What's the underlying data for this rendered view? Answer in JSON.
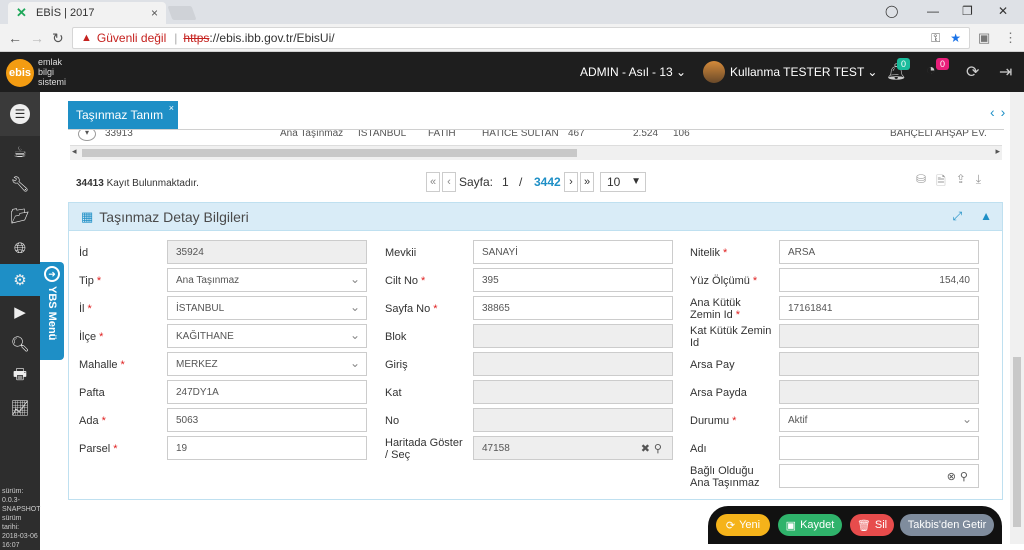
{
  "browser": {
    "tab_title": "EBİS | 2017",
    "tab_close": "×",
    "security_text": "Güvenli değil",
    "url_https": "https",
    "url_rest": "://ebis.ibb.gov.tr/EbisUi/"
  },
  "header": {
    "logo_text": "ebis",
    "logo_sub1": "emlak",
    "logo_sub2": "bilgi",
    "logo_sub3": "sistemi",
    "admin_label": "ADMIN - Asıl - 13",
    "user_label": "Kullanma TESTER TEST",
    "notif_count": "0",
    "alarm_count": "0"
  },
  "sidebar": {
    "ybs_label": "YBS Menü",
    "version_lines": [
      "sürüm:",
      "0.0.3-",
      "SNAPSHOT",
      "sürüm tarihi:",
      "2018-03-06",
      "16:07"
    ]
  },
  "page": {
    "tab_label": "Taşınmaz Tanım",
    "tab_close": "×"
  },
  "grid": {
    "partial_row": [
      "33913",
      "Ana Taşınmaz",
      "İSTANBUL",
      "FATİH",
      "HATİCE SULTAN",
      "467",
      "2.524",
      "106",
      "BAHÇELİ AHŞAP EV."
    ]
  },
  "pager": {
    "count_number": "34413",
    "count_text": " Kayıt Bulunmaktadır.",
    "page_label": "Sayfa:",
    "current_page": "1",
    "slash": "/",
    "total_pages": "3442",
    "page_size": "10"
  },
  "panel": {
    "title": "Taşınmaz Detay Bilgileri"
  },
  "form": {
    "col1": [
      {
        "label": "İd",
        "value": "35924",
        "required": false,
        "readonly": true
      },
      {
        "label": "Tip",
        "value": "Ana Taşınmaz",
        "required": true,
        "readonly": false,
        "dropdown": true
      },
      {
        "label": "İl",
        "value": "İSTANBUL",
        "required": true,
        "readonly": false,
        "dropdown": true
      },
      {
        "label": "İlçe",
        "value": "KAĞITHANE",
        "required": true,
        "readonly": false,
        "dropdown": true
      },
      {
        "label": "Mahalle",
        "value": "MERKEZ",
        "required": true,
        "readonly": false,
        "dropdown": true
      },
      {
        "label": "Pafta",
        "value": "247DY1A",
        "required": false,
        "readonly": false
      },
      {
        "label": "Ada",
        "value": "5063",
        "required": true,
        "readonly": false
      },
      {
        "label": "Parsel",
        "value": "19",
        "required": true,
        "readonly": false
      }
    ],
    "col2": [
      {
        "label": "Mevkii",
        "value": "SANAYİ",
        "required": false,
        "readonly": false
      },
      {
        "label": "Cilt No",
        "value": "395",
        "required": true,
        "readonly": false
      },
      {
        "label": "Sayfa No",
        "value": "38865",
        "required": true,
        "readonly": false
      },
      {
        "label": "Blok",
        "value": "",
        "required": false,
        "readonly": true
      },
      {
        "label": "Giriş",
        "value": "",
        "required": false,
        "readonly": true
      },
      {
        "label": "Kat",
        "value": "",
        "required": false,
        "readonly": true
      },
      {
        "label": "No",
        "value": "",
        "required": false,
        "readonly": true
      },
      {
        "label": "Haritada Göster / Seç",
        "value": "47158",
        "required": false,
        "readonly": true,
        "map": true
      }
    ],
    "col3": [
      {
        "label": "Nitelik",
        "value": "ARSA",
        "required": true,
        "readonly": false
      },
      {
        "label": "Yüz Ölçümü",
        "value": "154,40",
        "required": true,
        "readonly": false,
        "right": true
      },
      {
        "label": "Ana Kütük Zemin Id",
        "value": "17161841",
        "required": true,
        "readonly": false
      },
      {
        "label": "Kat Kütük Zemin Id",
        "value": "",
        "required": false,
        "readonly": true
      },
      {
        "label": "Arsa Pay",
        "value": "",
        "required": false,
        "readonly": true
      },
      {
        "label": "Arsa Payda",
        "value": "",
        "required": false,
        "readonly": true
      },
      {
        "label": "Durumu",
        "value": "Aktif",
        "required": true,
        "readonly": false,
        "dropdown": true
      },
      {
        "label": "Adı",
        "value": "",
        "required": false,
        "readonly": false
      },
      {
        "label": "Bağlı Olduğu Ana Taşınmaz",
        "value": "",
        "required": false,
        "readonly": false,
        "search": true
      }
    ]
  },
  "actions": {
    "new_label": "Yeni",
    "save_label": "Kaydet",
    "delete_label": "Sil",
    "return_label": "Takbis'den Getir"
  },
  "colors": {
    "accent": "#1e8fc6",
    "new": "#f5b31a",
    "save": "#2fb36b",
    "delete": "#e74c4c",
    "return": "#7f8c9d"
  }
}
